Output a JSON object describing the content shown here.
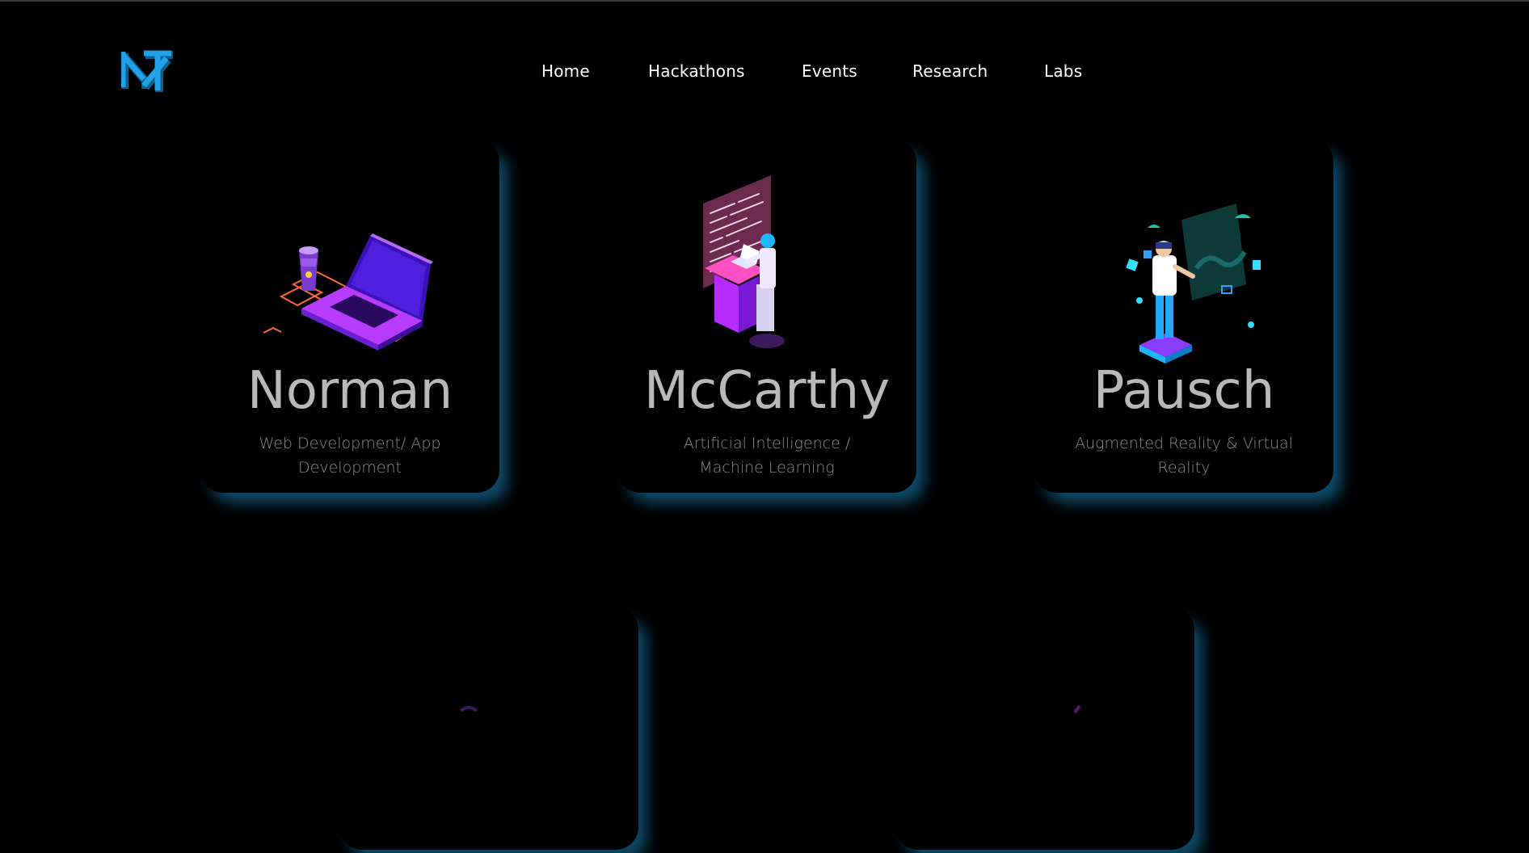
{
  "nav": {
    "items": [
      {
        "label": "Home"
      },
      {
        "label": "Hackathons"
      },
      {
        "label": "Events"
      },
      {
        "label": "Research"
      },
      {
        "label": "Labs"
      }
    ]
  },
  "logo": {
    "icon": "nt-logo-icon",
    "color": "#1a8fd4"
  },
  "cards": [
    {
      "title": "Norman",
      "subtitle": "Web Development/ App Development",
      "icon": "laptop-illustration"
    },
    {
      "title": "McCarthy",
      "subtitle": "Artificial Intelligence / Machine Learning",
      "icon": "ai-developer-illustration"
    },
    {
      "title": "Pausch",
      "subtitle": "Augmented Reality & Virtual Reality",
      "icon": "vr-user-illustration"
    }
  ],
  "colors": {
    "background": "#000000",
    "card_glow": "#1878aa",
    "title_text": "#b9b9b9",
    "subtitle_text": "#8c8c8c"
  }
}
